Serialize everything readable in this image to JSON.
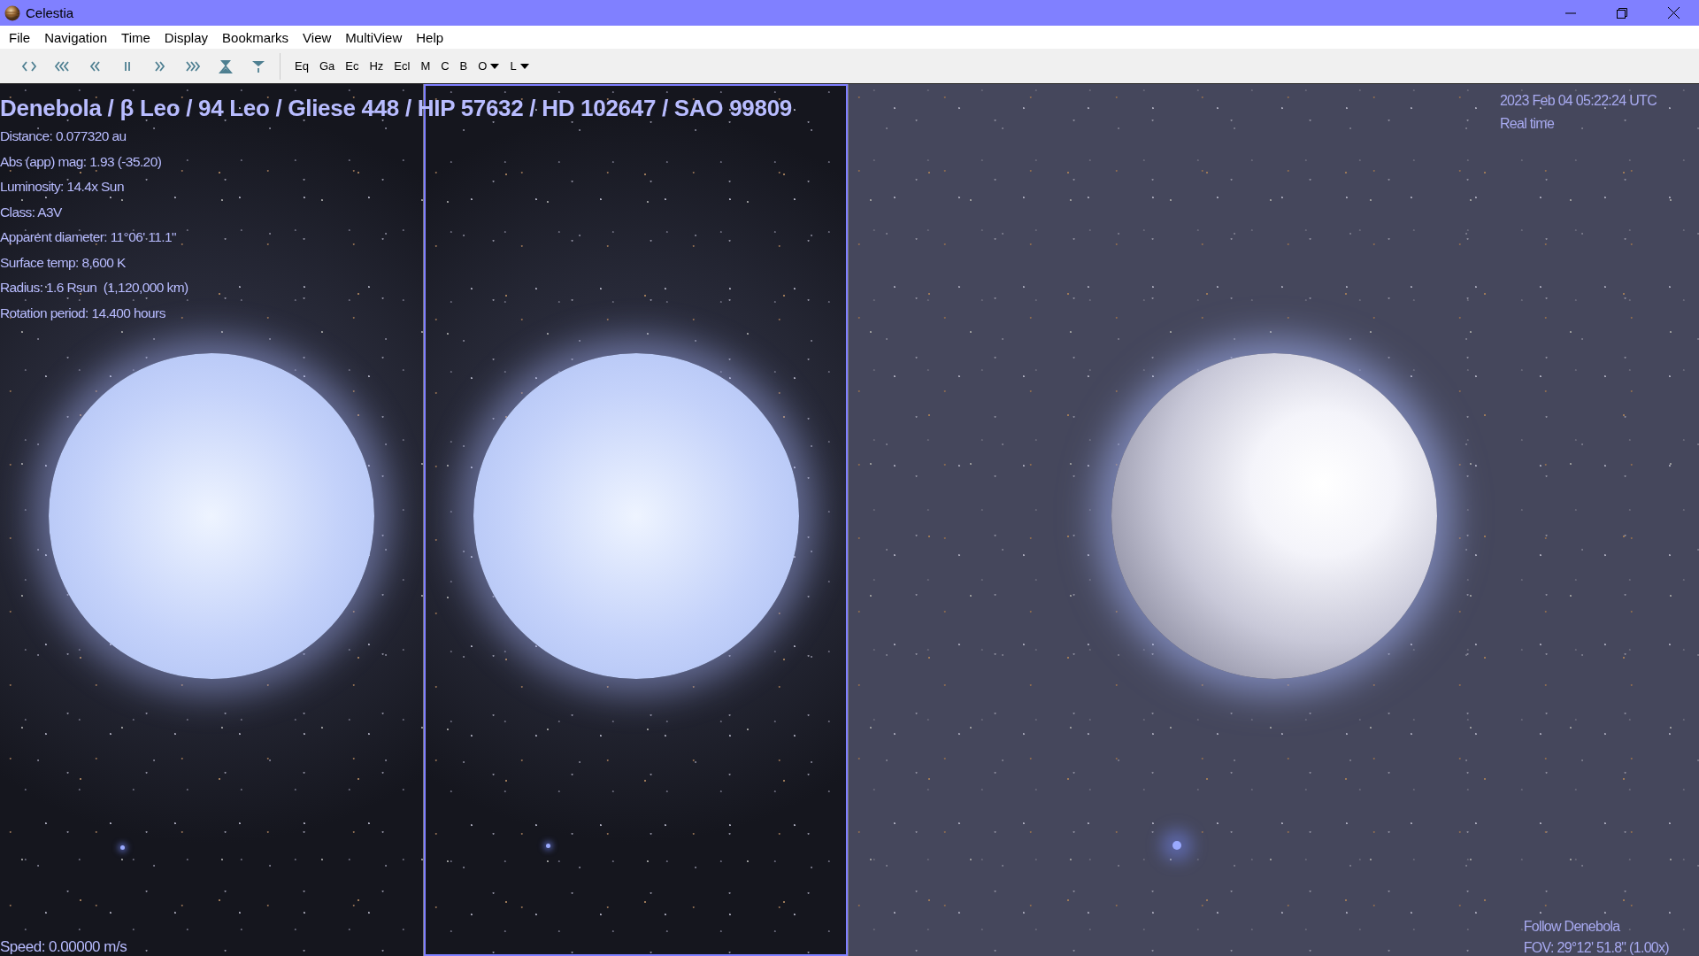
{
  "window": {
    "title": "Celestia"
  },
  "menu": [
    "File",
    "Navigation",
    "Time",
    "Display",
    "Bookmarks",
    "View",
    "MultiView",
    "Help"
  ],
  "toolbar": {
    "time_buttons": [
      {
        "kind": "reverse"
      },
      {
        "kind": "faster-back"
      },
      {
        "kind": "slower-back"
      },
      {
        "kind": "pause"
      },
      {
        "kind": "slower-forward"
      },
      {
        "kind": "faster-forward"
      },
      {
        "kind": "now"
      },
      {
        "kind": "filter"
      }
    ],
    "text_buttons": [
      {
        "label": "Eq",
        "dropdown": false
      },
      {
        "label": "Ga",
        "dropdown": false
      },
      {
        "label": "Ec",
        "dropdown": false
      },
      {
        "label": "Hz",
        "dropdown": false
      },
      {
        "label": "Ecl",
        "dropdown": false
      },
      {
        "label": "M",
        "dropdown": false
      },
      {
        "label": "C",
        "dropdown": false
      },
      {
        "label": "B",
        "dropdown": false
      },
      {
        "label": "O",
        "dropdown": true
      },
      {
        "label": "L",
        "dropdown": true
      }
    ]
  },
  "views": [
    {
      "kind": "glow",
      "selected": false
    },
    {
      "kind": "glow",
      "selected": true
    },
    {
      "kind": "shaded",
      "selected": false
    }
  ],
  "overlay": {
    "object_name": "Denebola / β Leo / 94 Leo / Gliese 448 / HIP 57632 / HD 102647 / SAO 99809",
    "info": [
      "Distance: 0.077320 au",
      "Abs (app) mag: 1.93 (-35.20)",
      "Luminosity: 14.4x Sun",
      "Class: A3V",
      "Apparent diameter: 11°06' 11.1\"",
      "Surface temp: 8,600 K",
      "Radius: 1.6 Rsun  (1,120,000 km)",
      "Rotation period: 14.400 hours"
    ],
    "date": "2023 Feb 04 05:22:24 UTC",
    "time_rate": "Real time",
    "speed": "Speed: 0.00000 m/s",
    "follow": "Follow Denebola",
    "fov": "FOV: 29°12' 51.8\" (1.00x)"
  }
}
